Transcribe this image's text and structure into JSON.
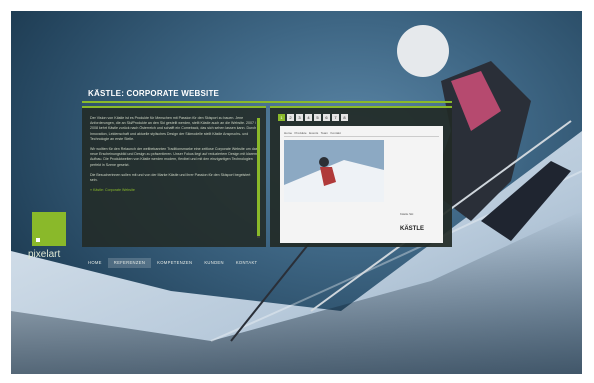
{
  "brand": "pixelart",
  "project_title": "KÄSTLE: CORPORATE WEBSITE",
  "description": {
    "paragraphs": [
      "Der Vision von Kästle ist es Produkte für Menschen mit Passion für den Skisport zu bauen. Jene Anforderungen, die an Ski/Produkte an den Ski gestellt werden, stellt Kästle auch an die Website. 2007 / 2008 kehrt Kästle zurück nach Österreich und schafft ein Comeback, das sich sehen lassen kann. Durch Innovation, Leidenschaft und aktuelle stylisches Design der Skimodelle stellt Kästle Anspruchs- und Technologie an erste Stelle.",
      "Wir wollten für den Relaunch der weltbekannten Traditionsmarke eine zeitlose Corporate Website um das neue Erscheinungsbild und Design zu präsentieren. Unser Fokus liegt auf reduziertem Design mit klarem Aufbau. Die Produktwelten von Kästle werden modern, flexibel und mit den einzigartigen Technologien perfekt in Szene gesetzt.",
      "Die Besucherinnen sollen mit und von der Marke Kästle und ihrer Passion für den Skisport begeistert sein."
    ],
    "link": "» Kästle: Corporate Website"
  },
  "preview": {
    "thumbs": [
      "1",
      "2",
      "3",
      "4",
      "5",
      "6",
      "7",
      "8"
    ],
    "active_thumb": 0,
    "nav_items": [
      "Home",
      "Produkte",
      "Events",
      "Team",
      "Kontakt"
    ],
    "caption": "Kästle Ski",
    "logo": "KÄSTLE"
  },
  "nav": {
    "items": [
      "HOME",
      "REFERENZEN",
      "KOMPETENZEN",
      "KUNDEN",
      "KONTAKT"
    ],
    "active": 1
  },
  "colors": {
    "accent": "#8ab92a",
    "panel": "#222a26",
    "sky": "#3e6684"
  }
}
